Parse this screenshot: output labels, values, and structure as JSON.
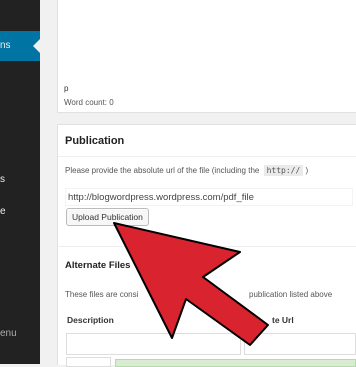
{
  "sidebar": {
    "items": [
      {
        "label": "ns",
        "active": true
      },
      {
        "label": "s"
      },
      {
        "label": "e"
      },
      {
        "label": "enu"
      }
    ]
  },
  "editor": {
    "path": "p",
    "word_count": "Word count: 0"
  },
  "publication": {
    "title": "Publication",
    "help_text": "Please provide the absolute url of the file (including the",
    "help_code": "http://",
    "help_suffix": ")",
    "url_value": "http://blogwordpress.wordpress.com/pdf_file",
    "upload_button": "Upload Publication"
  },
  "alternate_files": {
    "title": "Alternate Files",
    "description_start": "These files are consi",
    "description_end": "publication listed above",
    "columns": [
      "Description",
      "te Url"
    ]
  },
  "annotation": {
    "arrow_color": "#d9232f",
    "arrow_outline": "#000000"
  }
}
